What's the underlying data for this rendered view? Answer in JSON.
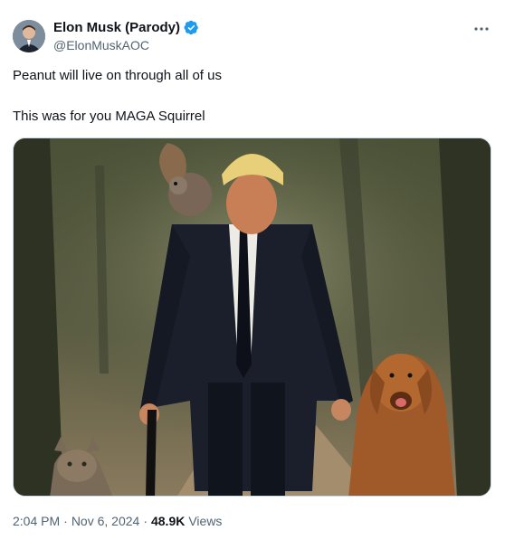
{
  "author": {
    "display_name": "Elon Musk (Parody)",
    "handle": "@ElonMuskAOC",
    "verified": true
  },
  "tweet": {
    "line1": "Peanut will live on through all of us",
    "line2": "This was for you MAGA Squirrel"
  },
  "meta": {
    "time": "2:04 PM",
    "separator1": "·",
    "date": "Nov 6, 2024",
    "separator2": "·",
    "views_count": "48.9K",
    "views_label": "Views"
  },
  "colors": {
    "verified_blue": "#1d9bf0",
    "text_primary": "#0f1419",
    "text_secondary": "#536471"
  },
  "icons": {
    "more": "more-dots-icon",
    "verified": "verified-badge-icon"
  }
}
